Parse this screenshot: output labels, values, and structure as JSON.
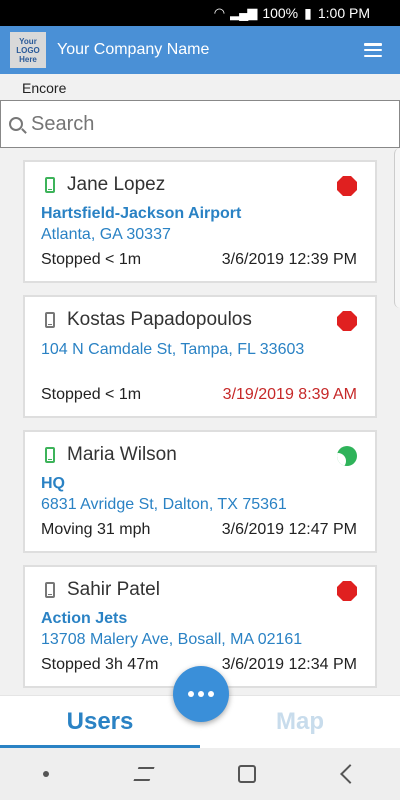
{
  "status_bar": {
    "signal": "📶",
    "battery": "100%",
    "time": "1:00 PM"
  },
  "header": {
    "logo_text": [
      "Your",
      "LOGO",
      "Here"
    ],
    "company": "Your Company Name",
    "menu_icon": "hamburger-icon"
  },
  "section_label": "Encore",
  "search": {
    "placeholder": "Search",
    "value": ""
  },
  "users": [
    {
      "name": "Jane Lopez",
      "device": "green",
      "status": "stopped",
      "place": "Hartsfield-Jackson Airport",
      "address": "Atlanta, GA 30337",
      "state": "Stopped < 1m",
      "timestamp": "3/6/2019 12:39 PM",
      "timestamp_alert": false
    },
    {
      "name": "Kostas Papadopoulos",
      "device": "gray",
      "status": "stopped",
      "place": "",
      "address": "104 N Camdale St, Tampa, FL 33603",
      "state": "Stopped < 1m",
      "timestamp": "3/19/2019 8:39 AM",
      "timestamp_alert": true
    },
    {
      "name": "Maria Wilson",
      "device": "green",
      "status": "moving",
      "place": "HQ",
      "address": "6831 Avridge St, Dalton, TX 75361",
      "state": "Moving 31 mph",
      "timestamp": "3/6/2019 12:47 PM",
      "timestamp_alert": false
    },
    {
      "name": "Sahir Patel",
      "device": "gray",
      "status": "stopped",
      "place": "Action Jets",
      "address": "13708 Malery Ave, Bosall, MA 02161",
      "state": "Stopped 3h 47m",
      "timestamp": "3/6/2019 12:34 PM",
      "timestamp_alert": false
    }
  ],
  "tabs": {
    "users": "Users",
    "map": "Map"
  },
  "colors": {
    "accent": "#2a82c4",
    "header": "#4a90d6",
    "stop": "#e02020",
    "moving": "#2fb35a",
    "alert_text": "#c62828"
  }
}
